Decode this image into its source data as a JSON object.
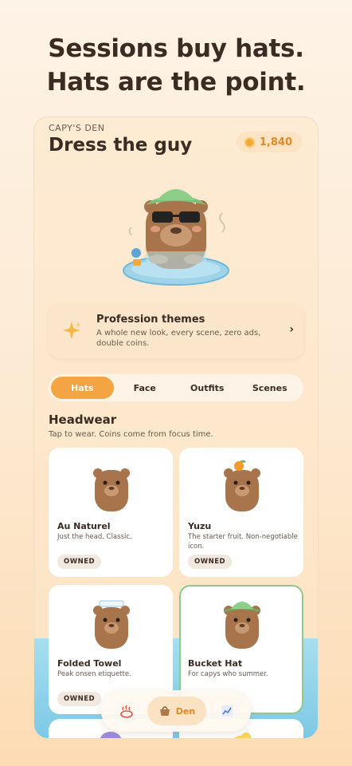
{
  "headline": {
    "line1": "Sessions buy hats.",
    "line2": "Hats are the point."
  },
  "app": {
    "section_label": "CAPY'S DEN",
    "title": "Dress the guy",
    "coins": "1,840"
  },
  "promo": {
    "title": "Profession themes",
    "subtitle": "A whole new look, every scene, zero ads, double coins.",
    "chevron": "›",
    "icon": "sparkle-icon"
  },
  "tabs": [
    {
      "label": "Hats",
      "active": true
    },
    {
      "label": "Face",
      "active": false
    },
    {
      "label": "Outfits",
      "active": false
    },
    {
      "label": "Scenes",
      "active": false
    }
  ],
  "section": {
    "title": "Headwear",
    "subtitle": "Tap to wear. Coins come from focus time."
  },
  "items": [
    {
      "name": "Au Naturel",
      "desc": "Just the head. Classic.",
      "badge": "OWNED",
      "hat": "none"
    },
    {
      "name": "Yuzu",
      "desc": "The starter fruit. Non-negotiable icon.",
      "badge": "OWNED",
      "hat": "yuzu"
    },
    {
      "name": "Folded Towel",
      "desc": "Peak onsen etiquette.",
      "badge": "OWNED",
      "hat": "towel"
    },
    {
      "name": "Bucket Hat",
      "desc": "For capys who summer.",
      "badge": "",
      "hat": "bucket",
      "selected": true
    }
  ],
  "nav": {
    "active_label": "Den",
    "items": [
      "onsen-icon",
      "basket-icon",
      "chart-icon"
    ]
  },
  "colors": {
    "accent": "#f5a443",
    "coin": "#e08a25",
    "selected_border": "#8fc98b",
    "water": "#7cc9e4"
  }
}
